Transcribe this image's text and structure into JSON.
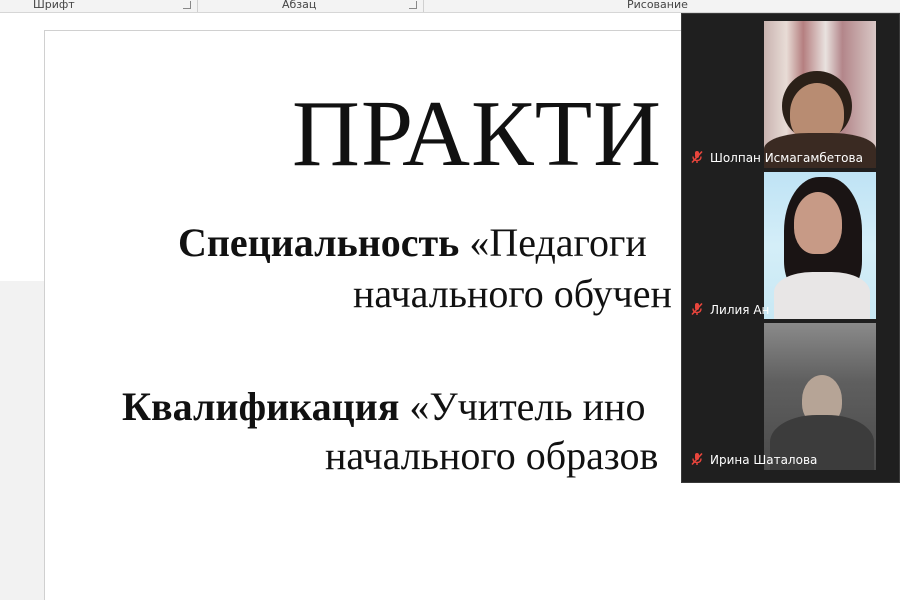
{
  "ribbon": {
    "groups": [
      {
        "label": "Шрифт"
      },
      {
        "label": "Абзац"
      },
      {
        "label": "Рисование"
      }
    ]
  },
  "document": {
    "title": "ПРАКТИ",
    "lines": [
      {
        "bold": "Специальность",
        "rest": " «Педагоги"
      },
      {
        "text": "начального обучен"
      },
      {
        "bold": "Квалификация",
        "rest": " «Учитель ино"
      },
      {
        "text": "начального образов"
      }
    ]
  },
  "video": {
    "participants": [
      {
        "name": "Шолпан Исмагамбетова",
        "muted": true
      },
      {
        "name": "Лилия Ан",
        "muted": true
      },
      {
        "name": "Ирина Шаталова",
        "muted": true
      }
    ],
    "muted_color": "#e8453c"
  }
}
